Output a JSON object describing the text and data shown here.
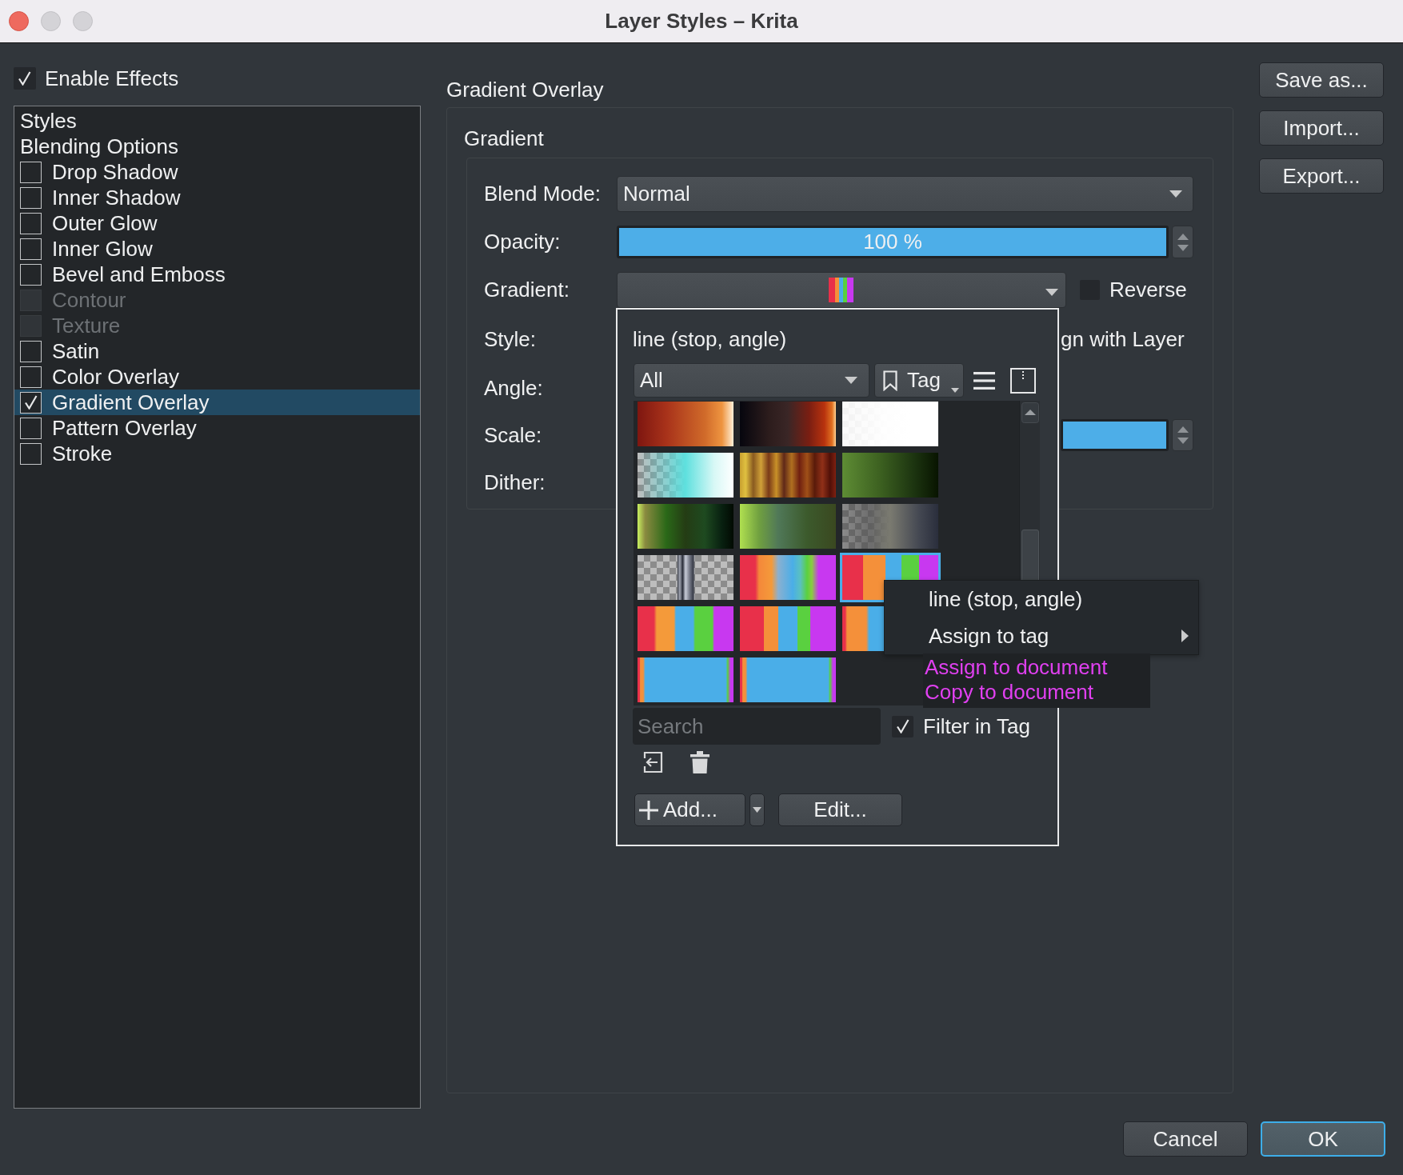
{
  "window": {
    "title": "Layer Styles – Krita"
  },
  "enable_effects": {
    "label": "Enable Effects",
    "checked": true
  },
  "styles_list": [
    {
      "kind": "header",
      "label": "Styles",
      "selected": false
    },
    {
      "kind": "header",
      "label": "Blending Options",
      "selected": false
    },
    {
      "kind": "effect",
      "label": "Drop Shadow",
      "checked": false,
      "disabled": false,
      "selected": false
    },
    {
      "kind": "effect",
      "label": "Inner Shadow",
      "checked": false,
      "disabled": false,
      "selected": false
    },
    {
      "kind": "effect",
      "label": "Outer Glow",
      "checked": false,
      "disabled": false,
      "selected": false
    },
    {
      "kind": "effect",
      "label": "Inner Glow",
      "checked": false,
      "disabled": false,
      "selected": false
    },
    {
      "kind": "effect",
      "label": "Bevel and Emboss",
      "checked": false,
      "disabled": false,
      "selected": false
    },
    {
      "kind": "effect",
      "label": "Contour",
      "checked": false,
      "disabled": true,
      "selected": false
    },
    {
      "kind": "effect",
      "label": "Texture",
      "checked": false,
      "disabled": true,
      "selected": false
    },
    {
      "kind": "effect",
      "label": "Satin",
      "checked": false,
      "disabled": false,
      "selected": false
    },
    {
      "kind": "effect",
      "label": "Color Overlay",
      "checked": false,
      "disabled": false,
      "selected": false
    },
    {
      "kind": "effect",
      "label": "Gradient Overlay",
      "checked": true,
      "disabled": false,
      "selected": true
    },
    {
      "kind": "effect",
      "label": "Pattern Overlay",
      "checked": false,
      "disabled": false,
      "selected": false
    },
    {
      "kind": "effect",
      "label": "Stroke",
      "checked": false,
      "disabled": false,
      "selected": false
    }
  ],
  "page_title": "Gradient Overlay",
  "group": {
    "title": "Gradient",
    "rows": [
      {
        "kind": "combo",
        "label": "Blend Mode:",
        "value": "Normal"
      },
      {
        "kind": "slider",
        "label": "Opacity:",
        "level": 1,
        "reading": "100 %"
      },
      {
        "kind": "gradient",
        "label": "Gradient:",
        "reverse": {
          "label": "Reverse",
          "checked": false
        }
      },
      {
        "kind": "covered_option",
        "label": "Style:",
        "text": "gn with Layer"
      },
      {
        "kind": "covered",
        "label": "Angle:"
      },
      {
        "kind": "covered_slider",
        "label": "Scale:",
        "level": 1
      },
      {
        "kind": "covered",
        "label": "Dither:"
      }
    ]
  },
  "gradient_popup": {
    "title": "line (stop, angle)",
    "tag_filter": "All",
    "tag_button": "Tag",
    "presets": [
      {
        "selected": false
      },
      {
        "selected": false
      },
      {
        "selected": false
      },
      {
        "selected": false
      },
      {
        "selected": false
      },
      {
        "selected": false
      },
      {
        "selected": false
      },
      {
        "selected": false
      },
      {
        "selected": false
      },
      {
        "selected": false
      },
      {
        "selected": false
      },
      {
        "selected": true
      },
      {
        "selected": false
      },
      {
        "selected": false
      },
      {
        "selected": false
      },
      {
        "selected": false
      },
      {
        "selected": false
      }
    ],
    "search": {
      "placeholder": "Search"
    },
    "filter_in_tag": {
      "label": "Filter in Tag",
      "checked": true
    },
    "add_button": "Add...",
    "edit_button": "Edit..."
  },
  "context_menu": [
    {
      "kind": "item",
      "label": "line (stop, angle)"
    },
    {
      "kind": "submenu",
      "label": "Assign to tag"
    }
  ],
  "submenu": [
    "Assign to document",
    "Copy to document"
  ],
  "side_buttons": [
    "Save as...",
    "Import...",
    "Export..."
  ],
  "dialog_buttons": [
    {
      "label": "Cancel",
      "default": false
    },
    {
      "label": "OK",
      "default": true
    }
  ]
}
